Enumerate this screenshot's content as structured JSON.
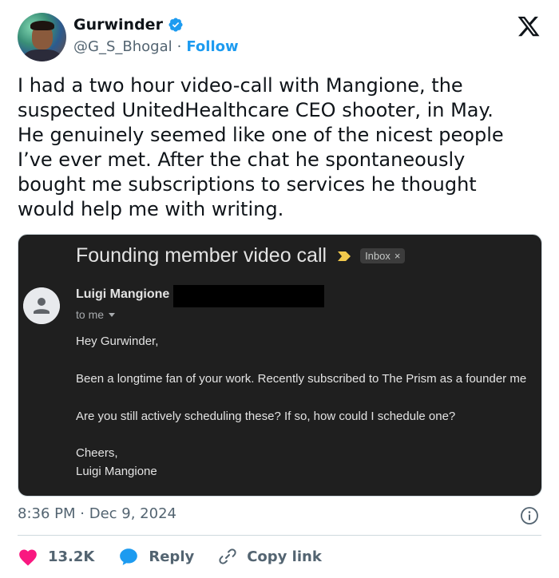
{
  "author": {
    "name": "Gurwinder",
    "handle": "@G_S_Bhogal",
    "separator": "·",
    "follow_label": "Follow"
  },
  "tweet": {
    "text": "I had a two hour video-call with Mangione, the\nsuspected UnitedHealthcare CEO shooter, in May.\nHe genuinely seemed like one of the nicest people\nI’ve ever met. After the chat he spontaneously\nbought me subscriptions to services he thought\nwould help me with writing.",
    "time": "8:36 PM",
    "date": "Dec 9, 2024",
    "meta_separator": "·"
  },
  "email": {
    "subject": "Founding member video call",
    "label_chip": "Inbox",
    "label_close": "×",
    "sender": "Luigi Mangione",
    "to": "to me",
    "greeting": "Hey Gurwinder,",
    "body_1": "Been a longtime fan of your work. Recently subscribed to The Prism as a founder me",
    "body_2": "Are you still actively scheduling these? If so, how could I schedule one?",
    "signoff": "Cheers,",
    "signature": "Luigi Mangione"
  },
  "actions": {
    "like_count": "13.2K",
    "reply_label": "Reply",
    "copy_label": "Copy link"
  },
  "colors": {
    "accent": "#1d9bf0",
    "like": "#f91880",
    "text_secondary": "#536471",
    "email_bg": "#1f1f1f"
  },
  "icons": [
    "verified-badge-icon",
    "x-logo-icon",
    "important-marker-icon",
    "person-icon",
    "caret-down-icon",
    "info-icon",
    "heart-icon",
    "reply-bubble-icon",
    "link-icon"
  ]
}
